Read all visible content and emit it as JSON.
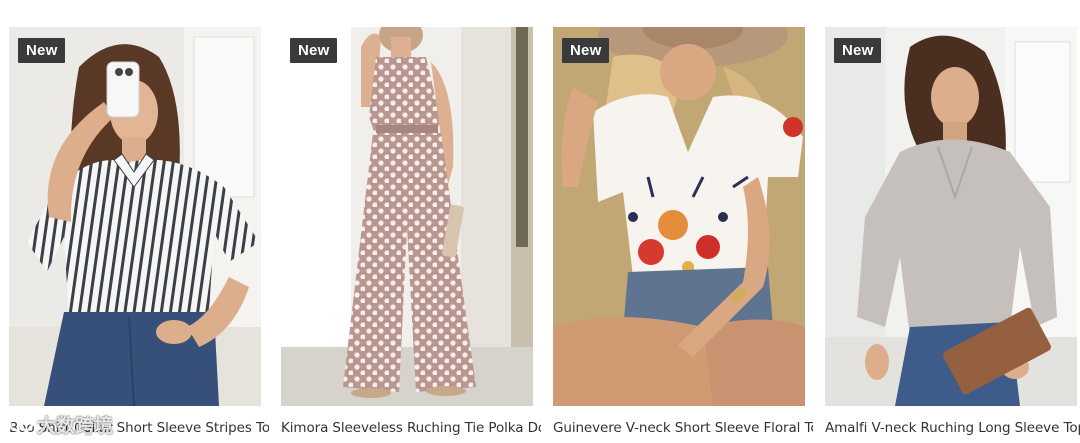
{
  "products": [
    {
      "badge": "New",
      "title": "Boo Shirt Collar Short Sleeve Stripes Top",
      "icon": "product-photo-striped-shirt"
    },
    {
      "badge": "New",
      "title": "Kimora Sleeveless Ruching Tie Polka Dot",
      "icon": "product-photo-polka-dot-jumpsuit"
    },
    {
      "badge": "New",
      "title": "Guinevere V-neck Short Sleeve Floral Top",
      "icon": "product-photo-floral-top"
    },
    {
      "badge": "New",
      "title": "Amalfi V-neck Ruching Long Sleeve Top",
      "icon": "product-photo-grey-blouse"
    }
  ],
  "watermark": {
    "text": "大数跨境"
  },
  "colors": {
    "badge_bg": "#3a3a3a",
    "badge_text": "#ffffff",
    "title_text": "#333333"
  }
}
